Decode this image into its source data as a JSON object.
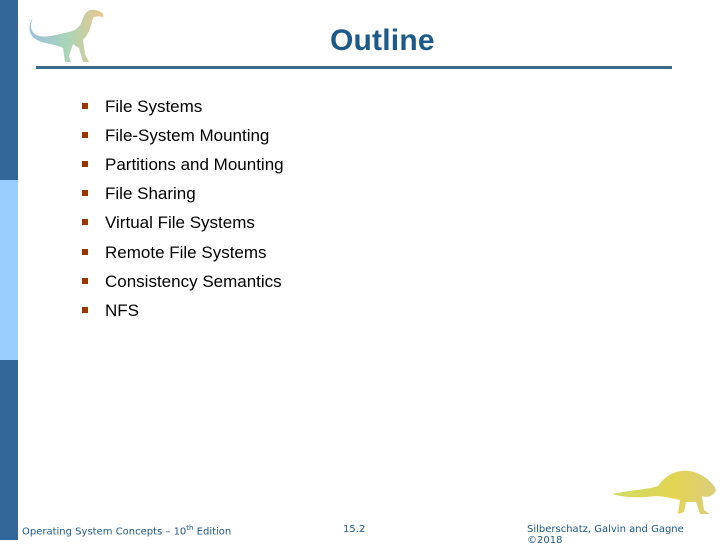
{
  "slide": {
    "title": "Outline",
    "bullets": [
      "File Systems",
      "File-System Mounting",
      "Partitions and Mounting",
      "File Sharing",
      "Virtual File Systems",
      "Remote File Systems",
      "Consistency Semantics",
      "NFS"
    ]
  },
  "footer": {
    "book_prefix": "Operating System Concepts – 10",
    "book_sup": "th",
    "book_suffix": " Edition",
    "page_number": "15.2",
    "copyright": "Silberschatz, Galvin and Gagne ©2018"
  },
  "colors": {
    "sidebar_dark": "#336699",
    "sidebar_light": "#99ccff",
    "title": "#1c5a8a",
    "rule": "#3e6a8c",
    "bullet": "#993300"
  },
  "icons": {
    "top_logo": "dinosaur-icon",
    "bottom_logo": "dinosaur-icon"
  }
}
